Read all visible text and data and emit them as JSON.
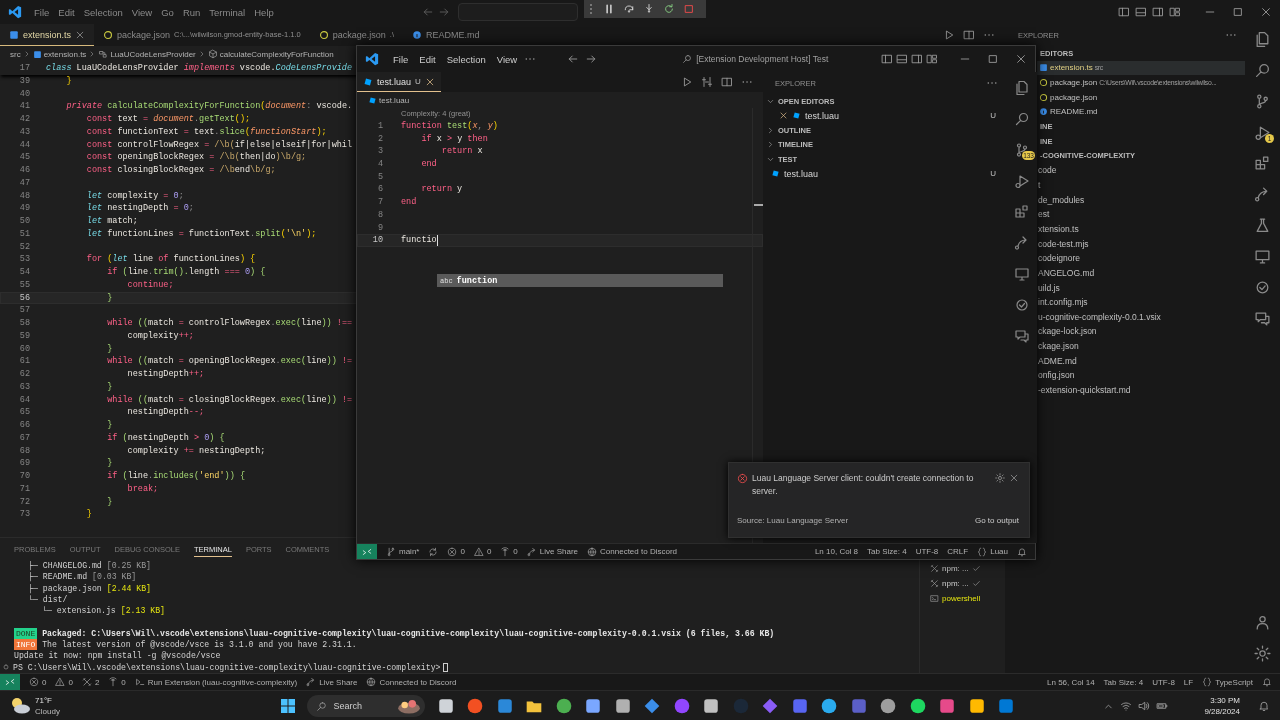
{
  "main": {
    "menu": [
      "File",
      "Edit",
      "Selection",
      "View",
      "Go",
      "Run",
      "Terminal",
      "Help"
    ],
    "tabs": [
      {
        "label": "extension.ts",
        "kind": "ts",
        "selected": true
      },
      {
        "label": "package.json",
        "detail": "C:\\...\\wilwilson.gmod-entity-base-1.1.0",
        "kind": "json",
        "selected": false
      },
      {
        "label": "package.json",
        "detail": ".\\",
        "kind": "json",
        "selected": false
      },
      {
        "label": "README.md",
        "kind": "info",
        "selected": false
      }
    ],
    "breadcrumbs": [
      {
        "label": "src",
        "kind": "folder"
      },
      {
        "label": "extension.ts",
        "kind": "ts"
      },
      {
        "label": "LuaUCodeLensProvider",
        "kind": "class"
      },
      {
        "label": "calculateComplexityForFunction",
        "kind": "method"
      }
    ],
    "code": [
      {
        "num": "17",
        "current": false,
        "tokens": [
          {
            "text": "class ",
            "kind": "st"
          },
          {
            "text": "LuaUCodeLensProvider ",
            "kind": "var"
          },
          {
            "text": "implements ",
            "kind": "kwi"
          },
          {
            "text": "vscode.",
            "kind": "var"
          },
          {
            "text": "CodeLensProvide",
            "kind": "type"
          }
        ]
      },
      {
        "num": "39",
        "current": false,
        "tokens": [
          {
            "text": "    }",
            "kind": "br"
          }
        ]
      },
      {
        "num": "40",
        "current": false
      },
      {
        "num": "41",
        "current": false,
        "tokens": [
          {
            "text": "    private ",
            "kind": "kwi"
          },
          {
            "text": "calculateComplexityForFunction",
            "kind": "fn"
          },
          {
            "text": "(",
            "kind": "br"
          },
          {
            "text": "document",
            "kind": "param"
          },
          {
            "text": ": ",
            "kind": "punc"
          },
          {
            "text": "vscode.",
            "kind": "var"
          }
        ]
      },
      {
        "num": "42",
        "current": false,
        "tokens": [
          {
            "text": "        const ",
            "kind": "kw"
          },
          {
            "text": "text ",
            "kind": "var"
          },
          {
            "text": "= ",
            "kind": "op"
          },
          {
            "text": "document",
            "kind": "param"
          },
          {
            "text": ".",
            "kind": "punc"
          },
          {
            "text": "getText",
            "kind": "fn"
          },
          {
            "text": "();",
            "kind": "br"
          }
        ]
      },
      {
        "num": "43",
        "current": false,
        "tokens": [
          {
            "text": "        const ",
            "kind": "kw"
          },
          {
            "text": "functionText ",
            "kind": "var"
          },
          {
            "text": "= ",
            "kind": "op"
          },
          {
            "text": "text",
            "kind": "var"
          },
          {
            "text": ".",
            "kind": "punc"
          },
          {
            "text": "slice",
            "kind": "fn"
          },
          {
            "text": "(",
            "kind": "br"
          },
          {
            "text": "functionStart",
            "kind": "param"
          },
          {
            "text": ");",
            "kind": "br"
          }
        ]
      },
      {
        "num": "44",
        "current": false,
        "tokens": [
          {
            "text": "        const ",
            "kind": "kw"
          },
          {
            "text": "controlFlowRegex ",
            "kind": "var"
          },
          {
            "text": "= ",
            "kind": "op"
          },
          {
            "text": "/\\b(",
            "kind": "re"
          },
          {
            "text": "if|else|elseif|for|whil",
            "kind": "var"
          }
        ]
      },
      {
        "num": "45",
        "current": false,
        "tokens": [
          {
            "text": "        const ",
            "kind": "kw"
          },
          {
            "text": "openingBlockRegex ",
            "kind": "var"
          },
          {
            "text": "= ",
            "kind": "op"
          },
          {
            "text": "/\\b(",
            "kind": "re"
          },
          {
            "text": "then|do",
            "kind": "var"
          },
          {
            "text": ")\\b/g;",
            "kind": "re"
          }
        ]
      },
      {
        "num": "46",
        "current": false,
        "tokens": [
          {
            "text": "        const ",
            "kind": "kw"
          },
          {
            "text": "closingBlockRegex ",
            "kind": "var"
          },
          {
            "text": "= ",
            "kind": "op"
          },
          {
            "text": "/\\b",
            "kind": "re"
          },
          {
            "text": "end",
            "kind": "var"
          },
          {
            "text": "\\b/g;",
            "kind": "re"
          }
        ]
      },
      {
        "num": "47",
        "current": false
      },
      {
        "num": "48",
        "current": false,
        "tokens": [
          {
            "text": "        let ",
            "kind": "st"
          },
          {
            "text": "complexity ",
            "kind": "var"
          },
          {
            "text": "= ",
            "kind": "op"
          },
          {
            "text": "0",
            "kind": "num"
          },
          {
            "text": ";",
            "kind": "punc"
          }
        ]
      },
      {
        "num": "49",
        "current": false,
        "tokens": [
          {
            "text": "        let ",
            "kind": "st"
          },
          {
            "text": "nestingDepth ",
            "kind": "var"
          },
          {
            "text": "= ",
            "kind": "op"
          },
          {
            "text": "0",
            "kind": "num"
          },
          {
            "text": ";",
            "kind": "punc"
          }
        ]
      },
      {
        "num": "50",
        "current": false,
        "tokens": [
          {
            "text": "        let ",
            "kind": "st"
          },
          {
            "text": "match;",
            "kind": "var"
          }
        ]
      },
      {
        "num": "51",
        "current": false,
        "tokens": [
          {
            "text": "        let ",
            "kind": "st"
          },
          {
            "text": "functionLines ",
            "kind": "var"
          },
          {
            "text": "= ",
            "kind": "op"
          },
          {
            "text": "functionText",
            "kind": "var"
          },
          {
            "text": ".",
            "kind": "punc"
          },
          {
            "text": "split",
            "kind": "fn"
          },
          {
            "text": "(",
            "kind": "br"
          },
          {
            "text": "'\\n'",
            "kind": "str"
          },
          {
            "text": ");",
            "kind": "br"
          }
        ]
      },
      {
        "num": "52",
        "current": false
      },
      {
        "num": "53",
        "current": false,
        "tokens": [
          {
            "text": "        for ",
            "kind": "kw"
          },
          {
            "text": "(",
            "kind": "br"
          },
          {
            "text": "let ",
            "kind": "st"
          },
          {
            "text": "line ",
            "kind": "var"
          },
          {
            "text": "of ",
            "kind": "kw"
          },
          {
            "text": "functionLines",
            "kind": "var"
          },
          {
            "text": ") {",
            "kind": "br"
          }
        ]
      },
      {
        "num": "54",
        "current": false,
        "tokens": [
          {
            "text": "            if ",
            "kind": "kw"
          },
          {
            "text": "(",
            "kind": "br2"
          },
          {
            "text": "line",
            "kind": "var"
          },
          {
            "text": ".",
            "kind": "punc"
          },
          {
            "text": "trim",
            "kind": "fn"
          },
          {
            "text": "().",
            "kind": "br2"
          },
          {
            "text": "length ",
            "kind": "var"
          },
          {
            "text": "=== ",
            "kind": "op"
          },
          {
            "text": "0",
            "kind": "num"
          },
          {
            "text": ") {",
            "kind": "br2"
          }
        ]
      },
      {
        "num": "55",
        "current": false,
        "tokens": [
          {
            "text": "                continue;",
            "kind": "kw"
          }
        ]
      },
      {
        "num": "56",
        "current": true,
        "tokens": [
          {
            "text": "            }",
            "kind": "br2"
          }
        ]
      },
      {
        "num": "57",
        "current": false
      },
      {
        "num": "58",
        "current": false,
        "tokens": [
          {
            "text": "            while ",
            "kind": "kw"
          },
          {
            "text": "((",
            "kind": "br2"
          },
          {
            "text": "match ",
            "kind": "var"
          },
          {
            "text": "= ",
            "kind": "op"
          },
          {
            "text": "controlFlowRegex",
            "kind": "var"
          },
          {
            "text": ".",
            "kind": "punc"
          },
          {
            "text": "exec",
            "kind": "fn"
          },
          {
            "text": "(",
            "kind": "br2"
          },
          {
            "text": "line",
            "kind": "var"
          },
          {
            "text": ")) ",
            "kind": "br2"
          },
          {
            "text": "!==",
            "kind": "op"
          }
        ]
      },
      {
        "num": "59",
        "current": false,
        "tokens": [
          {
            "text": "                complexity",
            "kind": "var"
          },
          {
            "text": "++;",
            "kind": "op"
          }
        ]
      },
      {
        "num": "60",
        "current": false,
        "tokens": [
          {
            "text": "            }",
            "kind": "br2"
          }
        ]
      },
      {
        "num": "61",
        "current": false,
        "tokens": [
          {
            "text": "            while ",
            "kind": "kw"
          },
          {
            "text": "((",
            "kind": "br2"
          },
          {
            "text": "match ",
            "kind": "var"
          },
          {
            "text": "= ",
            "kind": "op"
          },
          {
            "text": "openingBlockRegex",
            "kind": "var"
          },
          {
            "text": ".",
            "kind": "punc"
          },
          {
            "text": "exec",
            "kind": "fn"
          },
          {
            "text": "(",
            "kind": "br2"
          },
          {
            "text": "line",
            "kind": "var"
          },
          {
            "text": ")) ",
            "kind": "br2"
          },
          {
            "text": "!=",
            "kind": "op"
          }
        ]
      },
      {
        "num": "62",
        "current": false,
        "tokens": [
          {
            "text": "                nestingDepth",
            "kind": "var"
          },
          {
            "text": "++;",
            "kind": "op"
          }
        ]
      },
      {
        "num": "63",
        "current": false,
        "tokens": [
          {
            "text": "            }",
            "kind": "br2"
          }
        ]
      },
      {
        "num": "64",
        "current": false,
        "tokens": [
          {
            "text": "            while ",
            "kind": "kw"
          },
          {
            "text": "((",
            "kind": "br2"
          },
          {
            "text": "match ",
            "kind": "var"
          },
          {
            "text": "= ",
            "kind": "op"
          },
          {
            "text": "closingBlockRegex",
            "kind": "var"
          },
          {
            "text": ".",
            "kind": "punc"
          },
          {
            "text": "exec",
            "kind": "fn"
          },
          {
            "text": "(",
            "kind": "br2"
          },
          {
            "text": "line",
            "kind": "var"
          },
          {
            "text": ")) ",
            "kind": "br2"
          },
          {
            "text": "!=",
            "kind": "op"
          }
        ]
      },
      {
        "num": "65",
        "current": false,
        "tokens": [
          {
            "text": "                nestingDepth",
            "kind": "var"
          },
          {
            "text": "--;",
            "kind": "op"
          }
        ]
      },
      {
        "num": "66",
        "current": false,
        "tokens": [
          {
            "text": "            }",
            "kind": "br2"
          }
        ]
      },
      {
        "num": "67",
        "current": false,
        "tokens": [
          {
            "text": "            if ",
            "kind": "kw"
          },
          {
            "text": "(",
            "kind": "br2"
          },
          {
            "text": "nestingDepth ",
            "kind": "var"
          },
          {
            "text": "> ",
            "kind": "op"
          },
          {
            "text": "0",
            "kind": "num"
          },
          {
            "text": ") {",
            "kind": "br2"
          }
        ]
      },
      {
        "num": "68",
        "current": false,
        "tokens": [
          {
            "text": "                complexity ",
            "kind": "var"
          },
          {
            "text": "+= ",
            "kind": "op"
          },
          {
            "text": "nestingDepth;",
            "kind": "var"
          }
        ]
      },
      {
        "num": "69",
        "current": false,
        "tokens": [
          {
            "text": "            }",
            "kind": "br2"
          }
        ]
      },
      {
        "num": "70",
        "current": false,
        "tokens": [
          {
            "text": "            if ",
            "kind": "kw"
          },
          {
            "text": "(",
            "kind": "br2"
          },
          {
            "text": "line",
            "kind": "var"
          },
          {
            "text": ".",
            "kind": "punc"
          },
          {
            "text": "includes",
            "kind": "fn"
          },
          {
            "text": "(",
            "kind": "br2"
          },
          {
            "text": "'end'",
            "kind": "str"
          },
          {
            "text": ")) {",
            "kind": "br2"
          }
        ]
      },
      {
        "num": "71",
        "current": false,
        "tokens": [
          {
            "text": "                break;",
            "kind": "kw"
          }
        ]
      },
      {
        "num": "72",
        "current": false,
        "tokens": [
          {
            "text": "            }",
            "kind": "br2"
          }
        ]
      },
      {
        "num": "73",
        "current": false,
        "tokens": [
          {
            "text": "        }",
            "kind": "br"
          }
        ]
      }
    ],
    "panel_tabs": [
      {
        "label": "PROBLEMS",
        "selected": false
      },
      {
        "label": "OUTPUT",
        "selected": false
      },
      {
        "label": "DEBUG CONSOLE",
        "selected": false
      },
      {
        "label": "TERMINAL",
        "selected": true
      },
      {
        "label": "PORTS",
        "selected": false
      },
      {
        "label": "COMMENTS",
        "selected": false
      }
    ],
    "terminal": {
      "tree": [
        {
          "prefix": "├─",
          "name": "CHANGELOG.md",
          "size": "[0.25 KB]",
          "emphasis": false
        },
        {
          "prefix": "├─",
          "name": "README.md",
          "size": "[0.03 KB]",
          "emphasis": false
        },
        {
          "prefix": "├─",
          "name": "package.json",
          "size": "[2.44 KB]",
          "emphasis": true
        },
        {
          "prefix": "└─",
          "name": "dist/",
          "children": [
            {
              "prefix": "└─",
              "name": "extension.js",
              "size": "[2.13 KB]",
              "emphasis": true
            }
          ]
        }
      ],
      "messages": [
        {
          "kind": "done",
          "badge": "DONE",
          "text": "Packaged: C:\\Users\\Wil\\.vscode\\extensions\\luau-cognitive-complexity\\luau-cognitive-complexity\\luau-cognitive-complexity-0.0.1.vsix (6 files, 3.66 KB)"
        },
        {
          "kind": "info",
          "badge": "INFO",
          "text": "The latest version of @vscode/vsce is 3.1.0 and you have 2.31.1."
        },
        {
          "kind": "plain",
          "text": "Update it now: npm install -g @vscode/vsce"
        }
      ],
      "prompt": "PS C:\\Users\\Wil\\.vscode\\extensions\\luau-cognitive-complexity\\luau-cognitive-complexity>"
    },
    "terminals": [
      {
        "label": "npm: ...",
        "kind": "task",
        "selected": false
      },
      {
        "label": "npm: ...",
        "kind": "task",
        "selected": false
      },
      {
        "label": "powershell",
        "kind": "shell",
        "selected": true
      }
    ],
    "explorer": {
      "title": "EXPLORER",
      "rows": [
        {
          "label": "EDITORS",
          "kind": "section",
          "selected": false
        },
        {
          "label": "extension.ts",
          "detail": "src",
          "kind": "ts",
          "selected": true
        },
        {
          "label": "package.json",
          "detail": "C:\\Users\\Wil\\.vscode\\extensions\\wilwilso...",
          "kind": "json",
          "selected": false
        },
        {
          "label": "package.json",
          "kind": "json",
          "selected": false
        },
        {
          "label": "README.md",
          "kind": "info",
          "selected": false
        },
        {
          "label": "INE",
          "kind": "section",
          "selected": false
        },
        {
          "label": "INE",
          "kind": "section",
          "selected": false
        },
        {
          "label": "-COGNITIVE-COMPLEXITY",
          "kind": "section",
          "selected": false
        },
        {
          "label": "code",
          "kind": "cut",
          "selected": false
        },
        {
          "label": "t",
          "kind": "cut",
          "selected": false
        },
        {
          "label": "de_modules",
          "kind": "cut",
          "selected": false
        },
        {
          "label": "est",
          "kind": "cut",
          "selected": false
        },
        {
          "label": "xtension.ts",
          "kind": "cut",
          "selected": false
        },
        {
          "label": "code-test.mjs",
          "kind": "cut",
          "selected": false
        },
        {
          "label": "codeignore",
          "kind": "cut",
          "selected": false
        },
        {
          "label": "ANGELOG.md",
          "kind": "cut",
          "selected": false
        },
        {
          "label": "uild.js",
          "kind": "cut",
          "selected": false
        },
        {
          "label": "int.config.mjs",
          "kind": "cut",
          "selected": false
        },
        {
          "label": "u-cognitive-complexity-0.0.1.vsix",
          "kind": "cut",
          "selected": false
        },
        {
          "label": "ckage-lock.json",
          "kind": "cut",
          "selected": false
        },
        {
          "label": "ckage.json",
          "kind": "cut",
          "selected": false
        },
        {
          "label": "ADME.md",
          "kind": "cut",
          "selected": false
        },
        {
          "label": "onfig.json",
          "kind": "cut",
          "selected": false
        },
        {
          "label": "-extension-quickstart.md",
          "kind": "cut",
          "selected": false
        }
      ]
    },
    "run_badge": "1",
    "status_left": [
      {
        "kind": "remote"
      },
      {
        "kind": "errors",
        "text": "0"
      },
      {
        "kind": "warnings",
        "text": "0"
      },
      {
        "kind": "tools",
        "text": "2"
      },
      {
        "kind": "ports",
        "text": "0"
      },
      {
        "kind": "debug",
        "text": "Run Extension (luau-cognitive-complexity)"
      },
      {
        "kind": "liveshare",
        "text": "Live Share"
      },
      {
        "kind": "discord",
        "text": "Connected to Discord"
      }
    ],
    "status_right": [
      {
        "kind": "text",
        "text": "Ln 56, Col 14"
      },
      {
        "kind": "text",
        "text": "Tab Size: 4"
      },
      {
        "kind": "text",
        "text": "UTF-8"
      },
      {
        "kind": "text",
        "text": "LF"
      },
      {
        "kind": "language",
        "text": "TypeScript"
      },
      {
        "kind": "bell"
      }
    ]
  },
  "host": {
    "title": "[Extension Development Host] Test",
    "menu": [
      "File",
      "Edit",
      "Selection",
      "View"
    ],
    "tab": {
      "label": "test.luau",
      "status": "U",
      "selected": true
    },
    "breadcrumb": "test.luau",
    "codelens": "Complexity: 4 (great)",
    "code": [
      {
        "num": "1",
        "current": false,
        "tokens": [
          {
            "text": "function ",
            "kind": "kw"
          },
          {
            "text": "test",
            "kind": "fn"
          },
          {
            "text": "(",
            "kind": "br"
          },
          {
            "text": "x",
            "kind": "param"
          },
          {
            "text": ", ",
            "kind": "punc"
          },
          {
            "text": "y",
            "kind": "param"
          },
          {
            "text": ")",
            "kind": "br"
          }
        ]
      },
      {
        "num": "2",
        "current": false,
        "tokens": [
          {
            "text": "    if ",
            "kind": "kw"
          },
          {
            "text": "x ",
            "kind": "var"
          },
          {
            "text": "> ",
            "kind": "op"
          },
          {
            "text": "y ",
            "kind": "var"
          },
          {
            "text": "then",
            "kind": "kw"
          }
        ]
      },
      {
        "num": "3",
        "current": false,
        "tokens": [
          {
            "text": "        return ",
            "kind": "kw"
          },
          {
            "text": "x",
            "kind": "var"
          }
        ]
      },
      {
        "num": "4",
        "current": false,
        "tokens": [
          {
            "text": "    end",
            "kind": "kw"
          }
        ]
      },
      {
        "num": "5",
        "current": false
      },
      {
        "num": "6",
        "current": false,
        "tokens": [
          {
            "text": "    return ",
            "kind": "kw"
          },
          {
            "text": "y",
            "kind": "var"
          }
        ]
      },
      {
        "num": "7",
        "current": false,
        "tokens": [
          {
            "text": "end",
            "kind": "kw"
          }
        ]
      },
      {
        "num": "8",
        "current": false
      },
      {
        "num": "9",
        "current": false
      },
      {
        "num": "10",
        "current": true,
        "tokens": [
          {
            "text": "functio",
            "kind": "var"
          }
        ]
      }
    ],
    "suggestion": {
      "icon_text": "abc",
      "label": "function"
    },
    "explorer": {
      "title": "EXPLORER",
      "sections": [
        {
          "label": "OPEN EDITORS",
          "expanded": true,
          "items": [
            {
              "label": "test.luau",
              "status": "U",
              "kind": "open-editor"
            }
          ]
        },
        {
          "label": "OUTLINE",
          "expanded": false
        },
        {
          "label": "TIMELINE",
          "expanded": false
        },
        {
          "label": "TEST",
          "expanded": true,
          "items": [
            {
              "label": "test.luau",
              "status": "U",
              "kind": "file"
            }
          ]
        }
      ]
    },
    "scm_badge": "133",
    "status_left": [
      {
        "kind": "remote"
      },
      {
        "kind": "branch",
        "text": "main*"
      },
      {
        "kind": "sync"
      },
      {
        "kind": "errors",
        "text": "0"
      },
      {
        "kind": "warnings",
        "text": "0"
      },
      {
        "kind": "ports",
        "text": "0"
      },
      {
        "kind": "liveshare",
        "text": "Live Share"
      },
      {
        "kind": "discord",
        "text": "Connected to Discord"
      }
    ],
    "status_right": [
      {
        "kind": "text",
        "text": "Ln 10, Col 8"
      },
      {
        "kind": "text",
        "text": "Tab Size: 4"
      },
      {
        "kind": "text",
        "text": "UTF-8"
      },
      {
        "kind": "text",
        "text": "CRLF"
      },
      {
        "kind": "language",
        "text": "Luau"
      },
      {
        "kind": "bell"
      }
    ]
  },
  "notification": {
    "kind": "error",
    "message": "Luau Language Server client: couldn't create connection to server.",
    "source": "Source: Luau Language Server",
    "action": "Go to output"
  },
  "taskbar": {
    "temperature": "71°F",
    "condition": "Cloudy",
    "search": "Search",
    "time": "3:30 PM",
    "date": "9/28/2024"
  }
}
